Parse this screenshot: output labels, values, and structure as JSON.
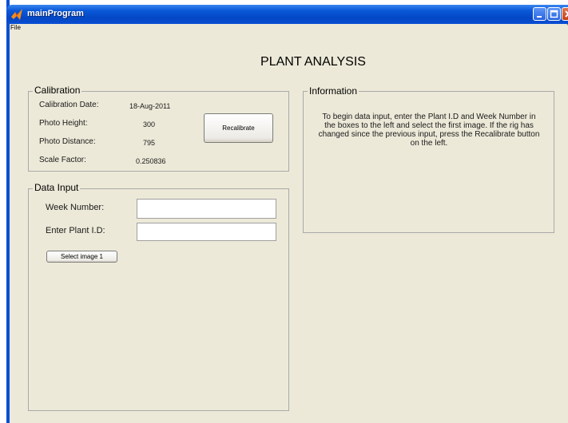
{
  "window": {
    "title": "mainProgram"
  },
  "menubar": {
    "file_label": "File",
    "corner_mark": "ʼ"
  },
  "main": {
    "heading": "PLANT ANALYSIS"
  },
  "calibration": {
    "title": "Calibration",
    "date_label": "Calibration Date:",
    "date_value": "18-Aug-2011",
    "height_label": "Photo Height:",
    "height_value": "300",
    "distance_label": "Photo Distance:",
    "distance_value": "795",
    "scale_label": "Scale Factor:",
    "scale_value": "0.250836",
    "recalibrate_label": "Recalibrate"
  },
  "data_input": {
    "title": "Data Input",
    "week_label": "Week Number:",
    "week_value": "",
    "plant_label": "Enter Plant I.D:",
    "plant_value": "",
    "select_label": "Select image 1"
  },
  "information": {
    "title": "Information",
    "text": "To begin data input, enter the Plant I.D and Week Number in the boxes to the left and select the first image. If the rig has changed since the previous input, press the Recalibrate button on the left."
  },
  "colors": {
    "titlebar_blue": "#0a4fd4",
    "face": "#ece9d8",
    "close_red": "#c24018"
  },
  "icons": {
    "app": "matlab-icon",
    "minimize": "minimize-icon",
    "maximize": "maximize-icon",
    "close": "close-icon"
  }
}
